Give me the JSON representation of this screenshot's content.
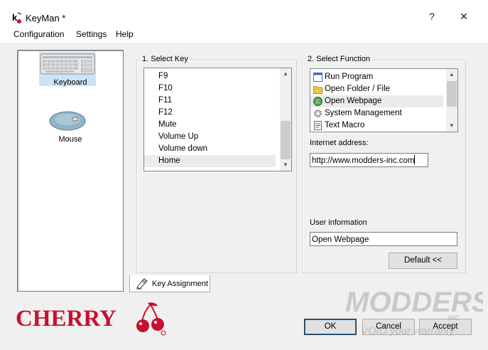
{
  "window": {
    "title": "KeyMan *",
    "help_glyph": "?",
    "minimize_glyph": "—",
    "close_glyph": "✕"
  },
  "menubar": {
    "items": [
      "Configuration",
      "Settings",
      "Help"
    ]
  },
  "devices": [
    {
      "label": "Keyboard",
      "icon": "keyboard-icon"
    },
    {
      "label": "Mouse",
      "icon": "mouse-icon"
    }
  ],
  "select_key": {
    "label": "1. Select Key",
    "items": [
      "F9",
      "F10",
      "F11",
      "F12",
      "Mute",
      "Volume Up",
      "Volume down",
      "Home"
    ],
    "selected": "Home"
  },
  "select_function": {
    "label": "2. Select Function",
    "items": [
      {
        "label": "Run Program",
        "icon": "window-icon"
      },
      {
        "label": "Open Folder / File",
        "icon": "folder-icon"
      },
      {
        "label": "Open Webpage",
        "icon": "globe-icon"
      },
      {
        "label": "System Management",
        "icon": "gear-icon"
      },
      {
        "label": "Text Macro",
        "icon": "notepad-icon"
      }
    ],
    "selected": "Open Webpage"
  },
  "internet_address": {
    "label": "Internet address:",
    "value": "http://www.modders-inc.com"
  },
  "user_information": {
    "label": "User information",
    "value": "Open Webpage"
  },
  "default_button": "Default <<",
  "tab": {
    "label": "Key Assignment"
  },
  "brand": {
    "name": "CHERRY",
    "color": "#c8102e"
  },
  "buttons": {
    "ok": "OK",
    "cancel": "Cancel",
    "accept": "Accept"
  },
  "watermark": {
    "line1": "MODDERS",
    "line2": "INC",
    "tagline": "VOID your warranty"
  }
}
